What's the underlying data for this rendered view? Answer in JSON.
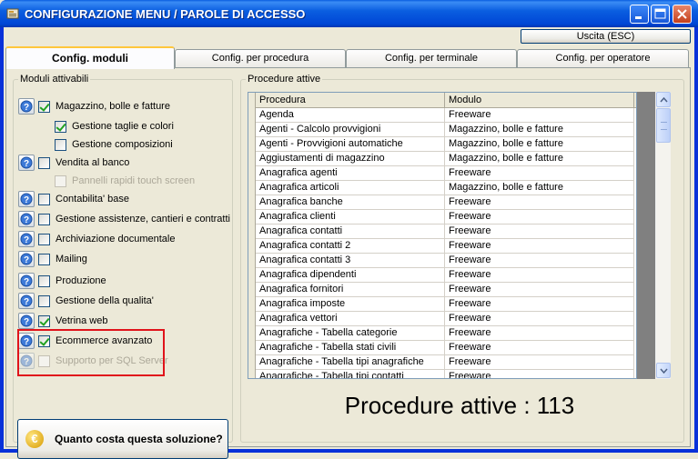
{
  "window": {
    "title": "CONFIGURAZIONE MENU / PAROLE DI ACCESSO"
  },
  "toolbar": {
    "exit_label": "Uscita (ESC)"
  },
  "tabs": [
    {
      "label": "Config. moduli",
      "active": true
    },
    {
      "label": "Config. per procedura",
      "active": false
    },
    {
      "label": "Config. per terminale",
      "active": false
    },
    {
      "label": "Config. per operatore",
      "active": false
    }
  ],
  "modules": {
    "group_label": "Moduli attivabili",
    "items": [
      {
        "label": "Magazzino, bolle e fatture",
        "checked": true,
        "enabled": true,
        "info": true
      },
      {
        "label": "Gestione taglie e colori",
        "checked": true,
        "enabled": true,
        "info": false
      },
      {
        "label": "Gestione composizioni",
        "checked": false,
        "enabled": true,
        "info": false
      },
      {
        "label": "Vendita al banco",
        "checked": false,
        "enabled": true,
        "info": true
      },
      {
        "label": "Pannelli rapidi touch screen",
        "checked": false,
        "enabled": false,
        "info": false
      },
      {
        "label": "Contabilita' base",
        "checked": false,
        "enabled": true,
        "info": true
      },
      {
        "label": "Gestione assistenze, cantieri e contratti",
        "checked": false,
        "enabled": true,
        "info": true
      },
      {
        "label": "Archiviazione documentale",
        "checked": false,
        "enabled": true,
        "info": true
      },
      {
        "label": "Mailing",
        "checked": false,
        "enabled": true,
        "info": true
      },
      {
        "label": "Produzione",
        "checked": false,
        "enabled": true,
        "info": true
      },
      {
        "label": "Gestione della qualita'",
        "checked": false,
        "enabled": true,
        "info": true
      },
      {
        "label": "Vetrina web",
        "checked": true,
        "enabled": true,
        "info": true
      },
      {
        "label": "Ecommerce avanzato",
        "checked": true,
        "enabled": true,
        "info": true
      },
      {
        "label": "Supporto per SQL Server",
        "checked": false,
        "enabled": false,
        "info": true
      }
    ],
    "price_button_label": "Quanto costa questa soluzione?",
    "price_icon": "€"
  },
  "procedures": {
    "group_label": "Procedure attive",
    "columns": [
      "Procedura",
      "Modulo"
    ],
    "rows": [
      [
        "Agenda",
        "Freeware"
      ],
      [
        "Agenti - Calcolo provvigioni",
        "Magazzino, bolle e fatture"
      ],
      [
        "Agenti - Provvigioni automatiche",
        "Magazzino, bolle e fatture"
      ],
      [
        "Aggiustamenti di magazzino",
        "Magazzino, bolle e fatture"
      ],
      [
        "Anagrafica agenti",
        "Freeware"
      ],
      [
        "Anagrafica articoli",
        "Magazzino, bolle e fatture"
      ],
      [
        "Anagrafica banche",
        "Freeware"
      ],
      [
        "Anagrafica clienti",
        "Freeware"
      ],
      [
        "Anagrafica contatti",
        "Freeware"
      ],
      [
        "Anagrafica contatti 2",
        "Freeware"
      ],
      [
        "Anagrafica contatti 3",
        "Freeware"
      ],
      [
        "Anagrafica dipendenti",
        "Freeware"
      ],
      [
        "Anagrafica fornitori",
        "Freeware"
      ],
      [
        "Anagrafica imposte",
        "Freeware"
      ],
      [
        "Anagrafica vettori",
        "Freeware"
      ],
      [
        "Anagrafiche - Tabella categorie",
        "Freeware"
      ],
      [
        "Anagrafiche - Tabella stati civili",
        "Freeware"
      ],
      [
        "Anagrafiche - Tabella tipi anagrafiche",
        "Freeware"
      ],
      [
        "Anagrafiche - Tabella tipi contatti",
        "Freeware"
      ]
    ],
    "count_label": "Procedure attive : 113"
  },
  "colors": {
    "highlight_box": "#e0131b",
    "titlebar": "#0a5ee0",
    "tab_active_accent": "#ffc73c"
  }
}
